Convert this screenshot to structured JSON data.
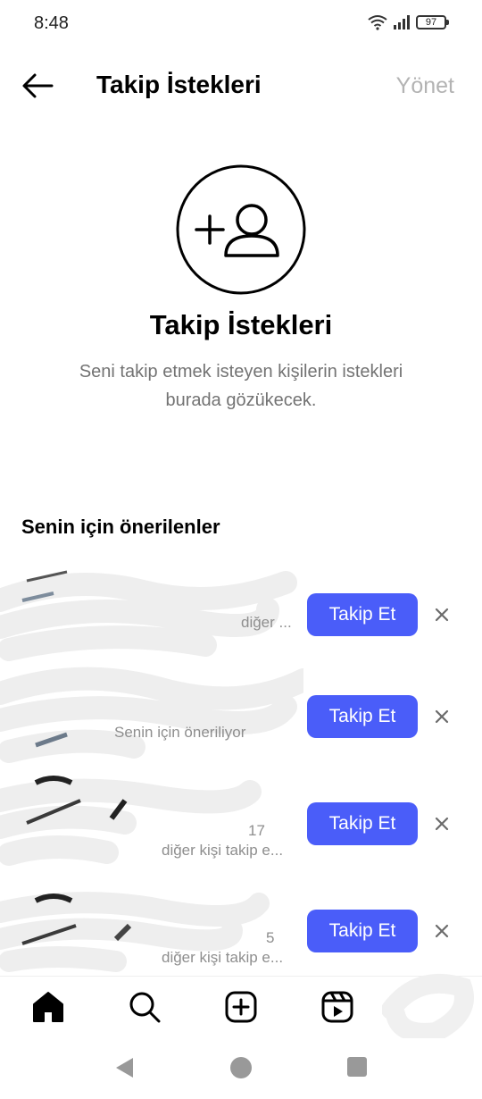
{
  "status_bar": {
    "time": "8:48",
    "battery": "97"
  },
  "header": {
    "title": "Takip İstekleri",
    "manage_label": "Yönet"
  },
  "empty_state": {
    "title": "Takip İstekleri",
    "description": "Seni takip etmek isteyen kişilerin istekleri burada gözükecek."
  },
  "suggestions": {
    "title": "Senin için önerilenler",
    "items": [
      {
        "line1": "",
        "line2": "diğer ...",
        "button": "Takip Et"
      },
      {
        "line1": "Senin için öneriliyor",
        "line2": "",
        "button": "Takip Et"
      },
      {
        "line1": "17",
        "line2": "diğer kişi takip e...",
        "button": "Takip Et"
      },
      {
        "line1": "5",
        "line2": "diğer kişi takip e...",
        "button": "Takip Et"
      }
    ]
  },
  "bottom_nav": {
    "items": [
      "home-icon",
      "search-icon",
      "create-icon",
      "reels-icon"
    ]
  },
  "colors": {
    "accent": "#4a5df9",
    "muted": "#b3b3b3",
    "secondary_text": "#737373"
  }
}
